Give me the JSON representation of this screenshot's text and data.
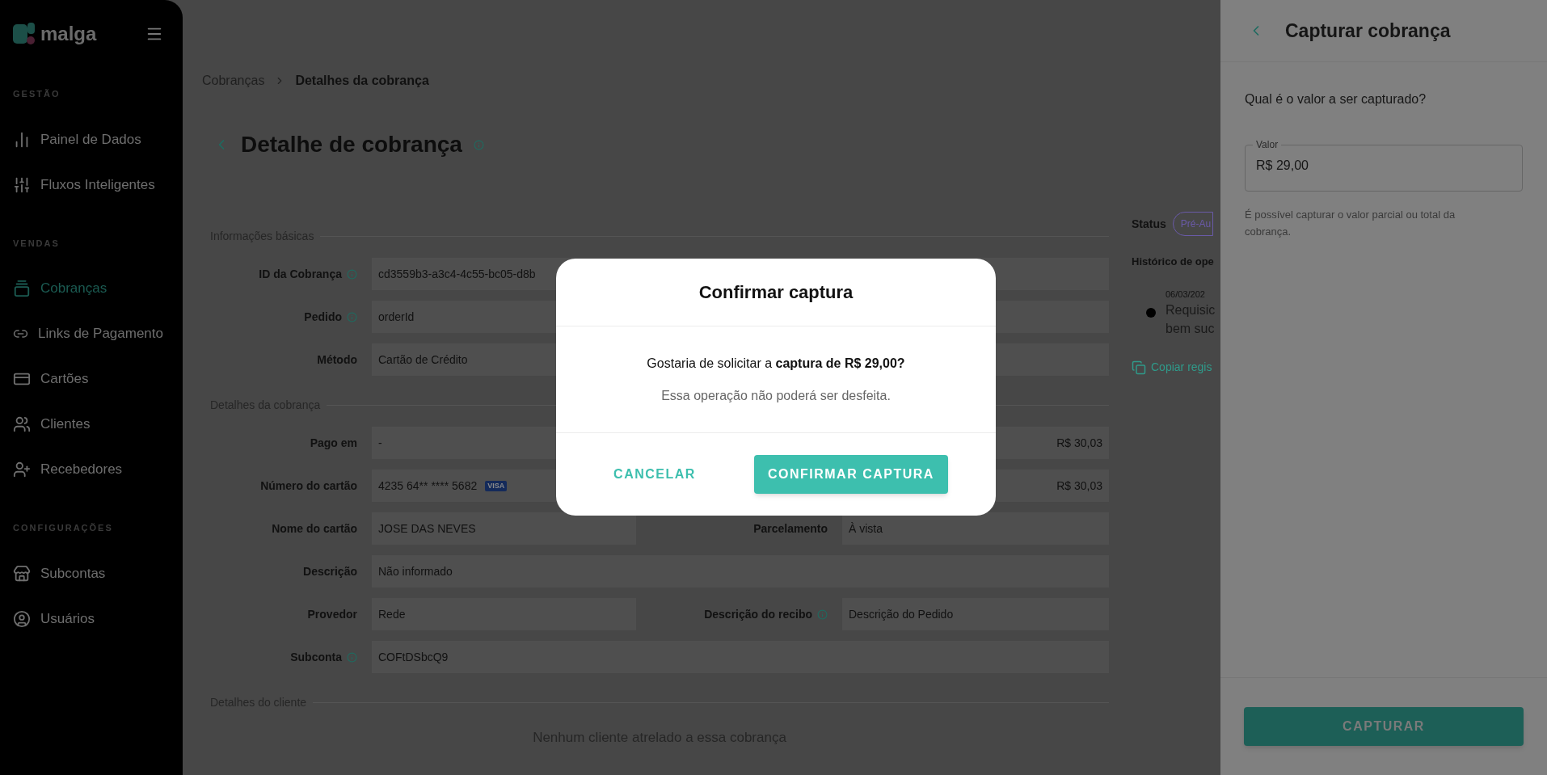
{
  "sidebar": {
    "logo": "malga",
    "sections": [
      {
        "title": "GESTÃO",
        "items": [
          {
            "label": "Painel de Dados",
            "selected": false
          },
          {
            "label": "Fluxos Inteligentes",
            "selected": false
          }
        ]
      },
      {
        "title": "VENDAS",
        "items": [
          {
            "label": "Cobranças",
            "selected": true
          },
          {
            "label": "Links de Pagamento",
            "selected": false
          },
          {
            "label": "Cartões",
            "selected": false
          },
          {
            "label": "Clientes",
            "selected": false
          },
          {
            "label": "Recebedores",
            "selected": false
          }
        ]
      },
      {
        "title": "CONFIGURAÇÕES",
        "items": [
          {
            "label": "Subcontas",
            "selected": false
          },
          {
            "label": "Usuários",
            "selected": false
          }
        ]
      }
    ]
  },
  "breadcrumb": [
    "Cobranças",
    "Detalhes da cobrança"
  ],
  "page_title": "Detalhe de cobrança",
  "sections": [
    {
      "title": "Informações básicas",
      "rows": [
        {
          "label": "ID da Cobrança",
          "info": true,
          "value": "cd3559b3-a3c4-4c55-bc05-d8b"
        },
        {
          "label": "Pedido",
          "info": true,
          "value": "orderId"
        },
        {
          "label": "Método",
          "info": false,
          "value": "Cartão de Crédito"
        }
      ]
    },
    {
      "title": "Detalhes da cobrança",
      "rows": [
        {
          "label": "Pago em",
          "info": false,
          "value": "-",
          "right_value": "R$ 30,03"
        },
        {
          "label": "Número do cartão",
          "info": false,
          "value": "4235 64** **** 5682",
          "card_brand": "VISA",
          "right_value": "R$ 30,03"
        },
        {
          "label": "Nome do cartão",
          "info": false,
          "value": "JOSE DAS NEVES",
          "right_label": "Parcelamento",
          "right_info": false,
          "right_value": "À vista"
        },
        {
          "label": "Descrição",
          "info": false,
          "value": "Não informado"
        },
        {
          "label": "Provedor",
          "info": false,
          "value": "Rede",
          "right_label": "Descrição do recibo",
          "right_info": true,
          "right_value": "Descrição do Pedido"
        },
        {
          "label": "Subconta",
          "info": true,
          "value": "COFtDSbcQ9"
        }
      ]
    },
    {
      "title": "Detalhes do cliente",
      "empty": "Nenhum cliente atrelado a essa cobrança"
    }
  ],
  "side_info": {
    "status_label": "Status",
    "status": "Pré-Au",
    "history_title": "Histórico de ope",
    "history": [
      {
        "date": "06/03/202",
        "text": "Requisic\nbem suc"
      }
    ],
    "copy_link": "Copiar regis"
  },
  "modal": {
    "title": "Confirmar captura",
    "message": "Gostaria de solicitar a **captura de R$ 29,00?**",
    "note": "Essa operação não poderá ser desfeita.",
    "cancel": "CANCELAR",
    "confirm": "CONFIRMAR CAPTURA"
  },
  "drawer": {
    "title": "Capturar cobrança",
    "question": "Qual é o valor a ser capturado?",
    "field": {
      "label": "Valor",
      "value": "R$ 29,00"
    },
    "helper": "É possível capturar o valor parcial ou total da cobrança.",
    "button": "CAPTURAR"
  }
}
